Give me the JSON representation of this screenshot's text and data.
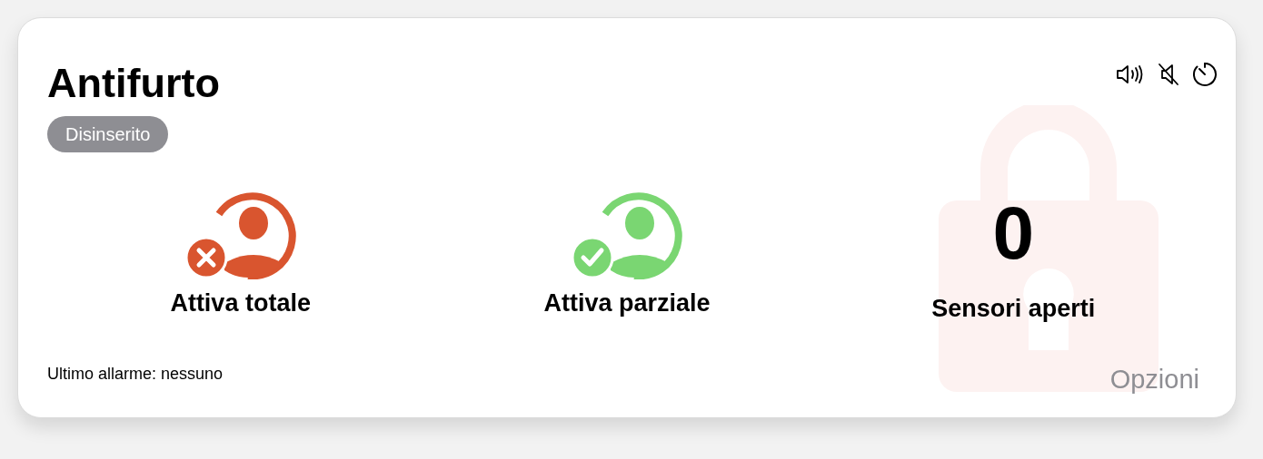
{
  "title": "Antifurto",
  "status": {
    "label": "Disinserito"
  },
  "actions": [
    {
      "kind": "total",
      "label": "Attiva totale",
      "color": "#d9552f"
    },
    {
      "kind": "partial",
      "label": "Attiva parziale",
      "color": "#7ad672"
    }
  ],
  "sensors": {
    "count": "0",
    "label": "Sensori aperti"
  },
  "last_alarm": "Ultimo allarme: nessuno",
  "options": "Opzioni"
}
